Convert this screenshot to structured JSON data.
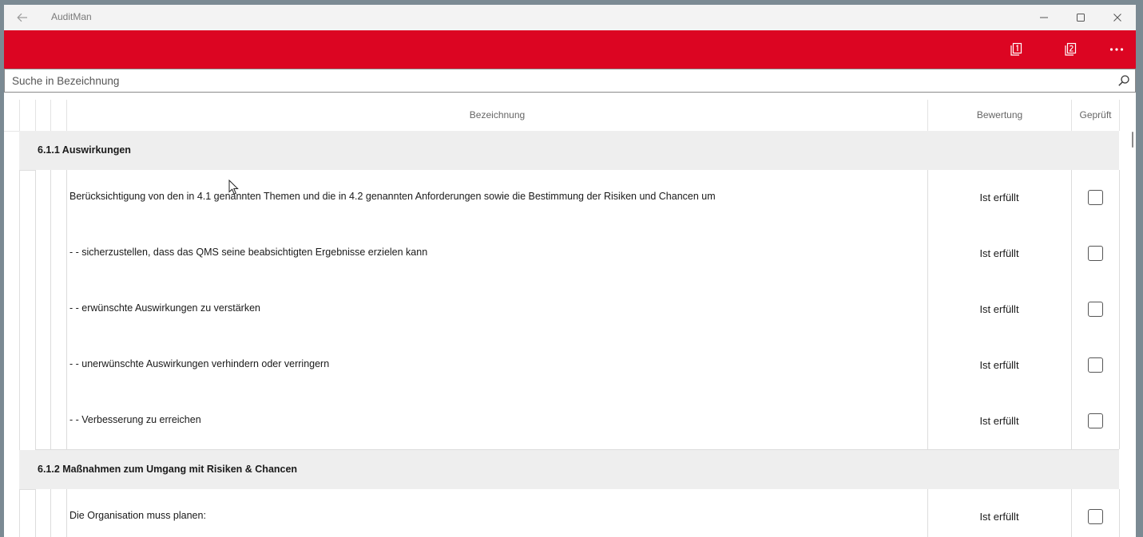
{
  "window": {
    "title": "AuditMan",
    "back_icon": "back-arrow-icon",
    "minimize_icon": "minimize-icon",
    "maximize_icon": "maximize-icon",
    "close_icon": "close-icon"
  },
  "commandbar": {
    "background": "#dc0522",
    "buttons": [
      "page-one-icon",
      "page-two-icon",
      "more-icon"
    ]
  },
  "search": {
    "placeholder": "Suche in Bezeichnung",
    "value": "",
    "icon": "search-icon"
  },
  "grid": {
    "columns": {
      "bezeichnung": "Bezeichnung",
      "bewertung": "Bewertung",
      "geprueft": "Geprüft"
    },
    "groups": [
      {
        "title": "6.1.1 Auswirkungen",
        "rows": [
          {
            "text": "Berücksichtigung von den in 4.1 genannten Themen und die in 4.2 genannten Anforderungen sowie die Bestimmung der Risiken und Chancen um",
            "bewertung": "Ist erfüllt",
            "checked": false
          },
          {
            "text": "- - sicherzustellen, dass das QMS seine beabsichtigten Ergebnisse erzielen kann",
            "bewertung": "Ist erfüllt",
            "checked": false
          },
          {
            "text": "- - erwünschte Auswirkungen zu verstärken",
            "bewertung": "Ist erfüllt",
            "checked": false
          },
          {
            "text": "- - unerwünschte Auswirkungen verhindern oder verringern",
            "bewertung": "Ist erfüllt",
            "checked": false
          },
          {
            "text": "- - Verbesserung zu erreichen",
            "bewertung": "Ist erfüllt",
            "checked": false
          }
        ]
      },
      {
        "title": "6.1.2 Maßnahmen zum Umgang mit Risiken & Chancen",
        "rows": [
          {
            "text": "Die Organisation muss planen:",
            "bewertung": "Ist erfüllt",
            "checked": false
          }
        ]
      }
    ]
  }
}
